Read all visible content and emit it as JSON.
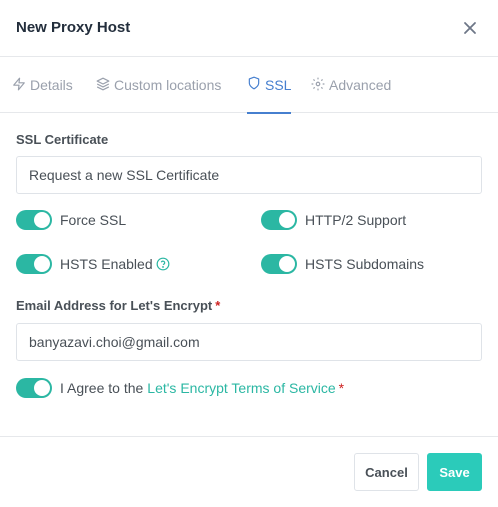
{
  "modal": {
    "title": "New Proxy Host"
  },
  "tabs": [
    {
      "label": "Details",
      "icon": "zap-icon",
      "active": false
    },
    {
      "label": "Custom locations",
      "icon": "layers-icon",
      "active": false
    },
    {
      "label": "SSL",
      "icon": "shield-icon",
      "active": true
    },
    {
      "label": "Advanced",
      "icon": "gear-icon",
      "active": false
    }
  ],
  "ssl": {
    "certificate_label": "SSL Certificate",
    "certificate_value": "Request a new SSL Certificate",
    "toggles": {
      "force_ssl": {
        "label": "Force SSL",
        "on": true
      },
      "http2": {
        "label": "HTTP/2 Support",
        "on": true
      },
      "hsts_enabled": {
        "label": "HSTS Enabled",
        "on": true
      },
      "hsts_subdomains": {
        "label": "HSTS Subdomains",
        "on": true
      }
    },
    "email_label": "Email Address for Let's Encrypt",
    "required_marker": "*",
    "email_value": "banyazavi.choi@gmail.com",
    "agree_prefix": "I Agree to the",
    "agree_link": "Let's Encrypt Terms of Service",
    "agree_on": true
  },
  "footer": {
    "cancel_label": "Cancel",
    "save_label": "Save"
  },
  "colors": {
    "accent": "#2bcbba",
    "toggle": "#2bb7a3",
    "active_tab": "#467fcf",
    "required": "#cd201f"
  }
}
